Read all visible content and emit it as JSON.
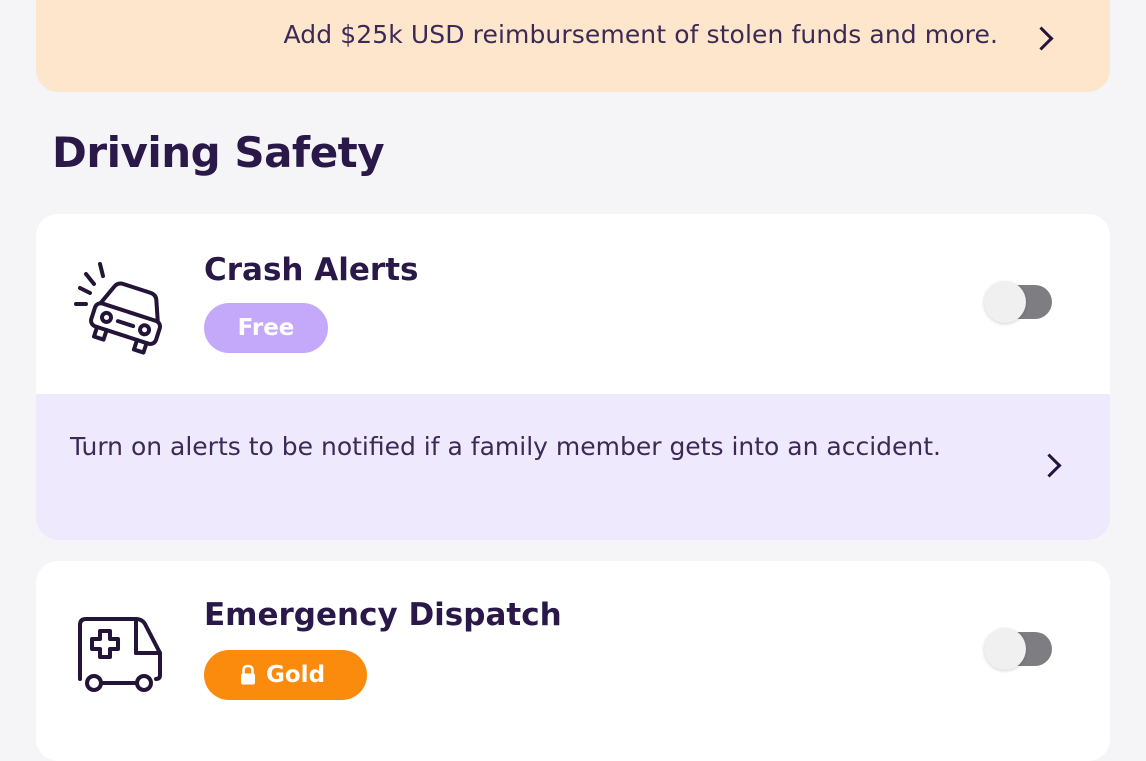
{
  "promo": {
    "text": "Add $25k USD reimbursement of stolen funds and more.",
    "icon": "chevron-right-icon"
  },
  "section": {
    "title": "Driving Safety"
  },
  "features": [
    {
      "title": "Crash Alerts",
      "badge": "Free",
      "badge_color": "#c4a8fa",
      "icon": "car-crash-icon",
      "toggle_on": false,
      "info_text": "Turn on alerts to be notified if a family member gets into an accident.",
      "info_icon": "chevron-right-icon"
    },
    {
      "title": "Emergency Dispatch",
      "badge": "Gold",
      "badge_color": "#fa8b0d",
      "badge_icon": "lock-icon",
      "icon": "ambulance-icon",
      "toggle_on": false
    }
  ],
  "colors": {
    "background": "#f5f5f8",
    "promo_background": "#fde6cc",
    "info_background": "#efe9fd",
    "title_text": "#291848"
  }
}
